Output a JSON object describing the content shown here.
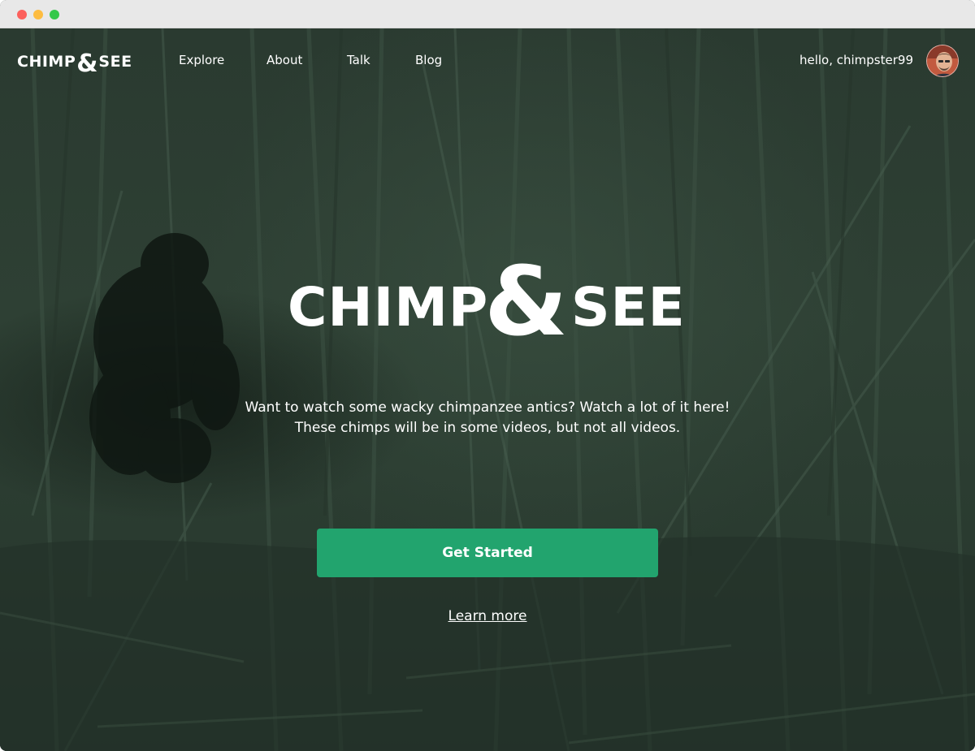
{
  "app": {
    "logo": {
      "word1": "CHIMP",
      "ampersand": "&",
      "word2": "SEE"
    }
  },
  "nav": {
    "items": [
      {
        "label": "Explore"
      },
      {
        "label": "About"
      },
      {
        "label": "Talk"
      },
      {
        "label": "Blog"
      }
    ],
    "greeting": "hello, chimpster99",
    "avatar_icon": "user-avatar"
  },
  "hero": {
    "title": {
      "word1": "CHIMP",
      "ampersand": "&",
      "word2": "SEE"
    },
    "tagline_line1": "Want to watch some wacky chimpanzee antics? Watch a lot of it here!",
    "tagline_line2": "These chimps will be in some videos, but not all videos.",
    "cta_label": "Get Started",
    "learn_more_label": "Learn more",
    "background_image": "chimpanzee-in-bamboo-forest-photo"
  },
  "colors": {
    "accent": "#22a46e",
    "overlay": "#2a3b30",
    "text": "#ffffff"
  }
}
